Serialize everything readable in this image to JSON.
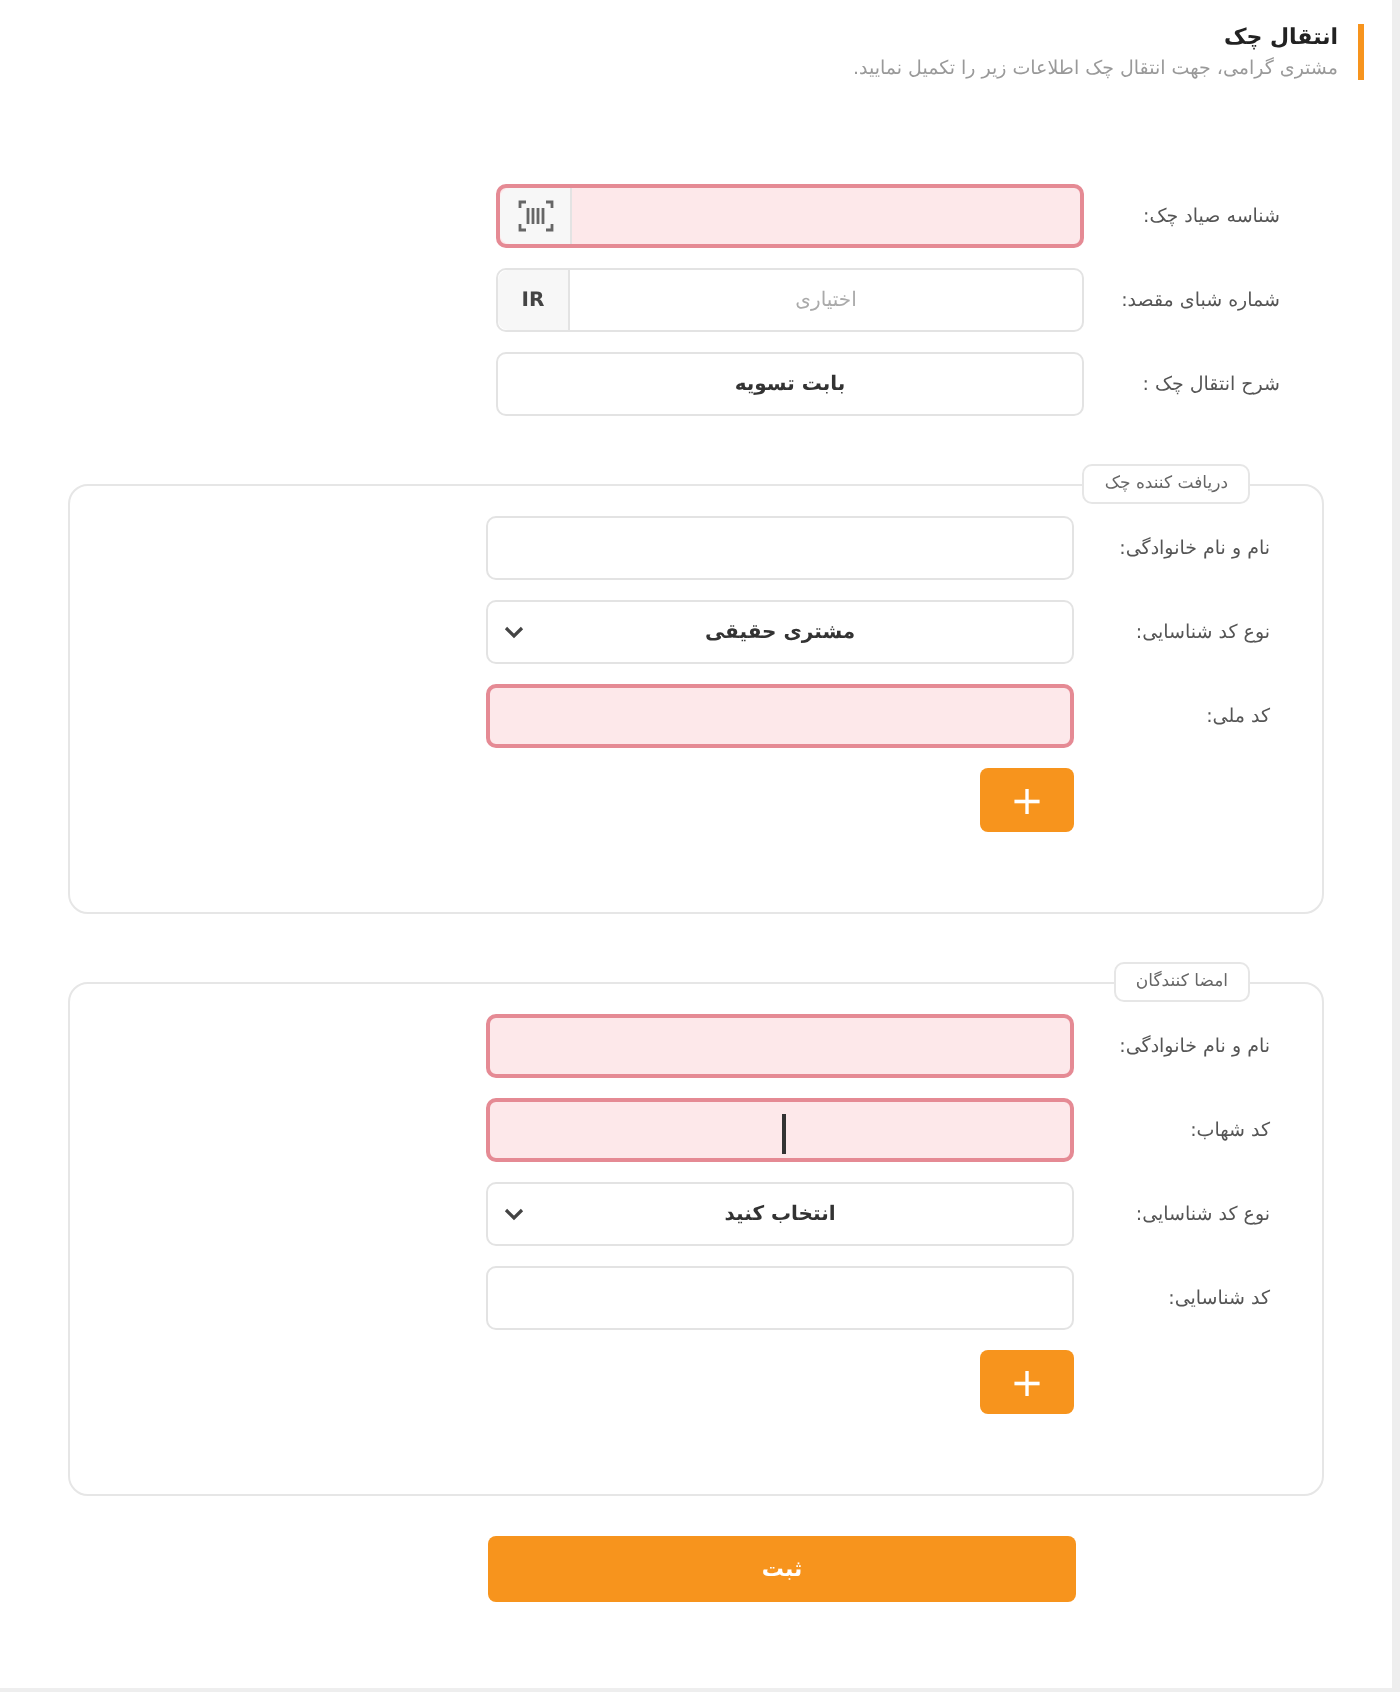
{
  "header": {
    "title": "انتقال چک",
    "subtitle": "مشتری گرامی، جهت انتقال چک اطلاعات زیر را تکمیل نمایید."
  },
  "fields": [
    {
      "label": "شناسه صیاد چک:",
      "kind": "input",
      "error": true,
      "addon": {
        "kind": "scanner"
      }
    },
    {
      "label": "شماره شبای مقصد:",
      "kind": "input",
      "error": false,
      "placeholder": "اختیاری",
      "addon": {
        "kind": "text",
        "text": "IR"
      }
    },
    {
      "label": "شرح انتقال چک :",
      "kind": "input",
      "error": false,
      "value": "بابت تسویه"
    }
  ],
  "groups": [
    {
      "legend": "دریافت کننده چک",
      "fields": [
        {
          "label": "نام و نام خانوادگی:",
          "kind": "input",
          "error": false
        },
        {
          "label": "نوع کد شناسایی:",
          "kind": "select",
          "error": false,
          "value": "مشتری حقیقی"
        },
        {
          "label": "کد ملی:",
          "kind": "input",
          "error": true
        }
      ],
      "add_button": "+"
    },
    {
      "legend": "امضا کنندگان",
      "fields": [
        {
          "label": "نام و نام خانوادگی:",
          "kind": "input",
          "error": true
        },
        {
          "label": "کد شهاب:",
          "kind": "input",
          "error": true,
          "focused": true
        },
        {
          "label": "نوع کد شناسایی:",
          "kind": "select",
          "error": false,
          "value": "انتخاب کنید"
        },
        {
          "label": "کد شناسایی:",
          "kind": "input",
          "error": false
        }
      ],
      "add_button": "+"
    }
  ],
  "submit": "ثبت"
}
